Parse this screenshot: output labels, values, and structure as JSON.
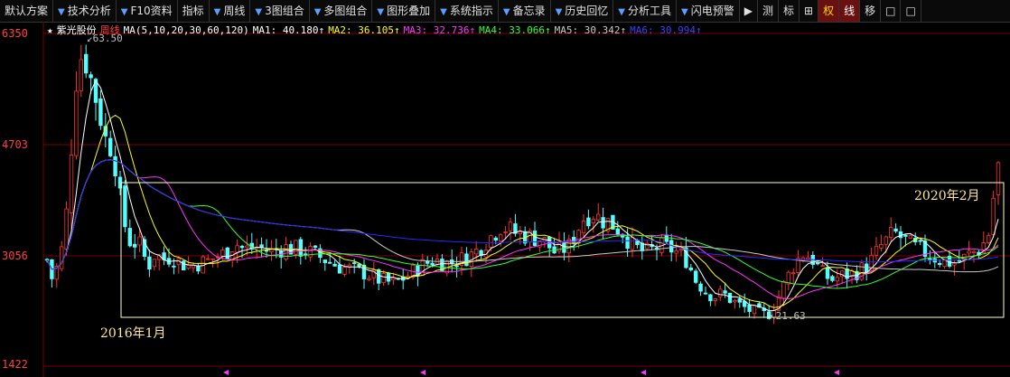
{
  "toolbar": {
    "items": [
      "默认方案",
      "技术分析",
      "F10资料",
      "指标",
      "周线",
      "3图组合",
      "多图组合",
      "图形叠加",
      "系统指示",
      "备忘录",
      "历史回忆",
      "分析工具",
      "闪电预警",
      "▶",
      "测",
      "标",
      "⊞",
      "权",
      "线",
      "移",
      "□",
      "□"
    ]
  },
  "legend": {
    "stock": "紫光股份",
    "period": "周线",
    "ma_def": "MA(5,10,20,30,60,120)",
    "ma1": "MA1: 40.180↑",
    "ma2": "MA2: 36.105↑",
    "ma3": "MA3: 32.736↑",
    "ma4": "MA4: 33.066↑",
    "ma5": "MA5: 30.342↑",
    "ma6": "MA6: 30.994↑"
  },
  "colors": {
    "up": "#ff3232",
    "down": "#54ffff",
    "ma1": "#ffffff",
    "ma2": "#ffff00",
    "ma3": "#ff33ff",
    "ma4": "#33ff33",
    "ma5": "#c8c8c8",
    "ma6": "#2828ff",
    "grid": "#7a0000",
    "box": "#ffffcc"
  },
  "annotations": {
    "start": "2016年1月",
    "end": "2020年2月",
    "high": "63.50",
    "low": "21.63"
  },
  "chart_data": {
    "type": "candlestick",
    "y_ticks": [
      {
        "value": 63.5,
        "label": "6350"
      },
      {
        "value": 47.03,
        "label": "4703"
      },
      {
        "value": 30.56,
        "label": "3056"
      },
      {
        "value": 14.22,
        "label": "1422"
      }
    ],
    "high": 63.5,
    "low": 21.63,
    "ma_last": {
      "ma1": 40.18,
      "ma2": 36.105,
      "ma3": 32.736,
      "ma4": 33.066,
      "ma5": 30.342,
      "ma6": 30.994
    }
  }
}
